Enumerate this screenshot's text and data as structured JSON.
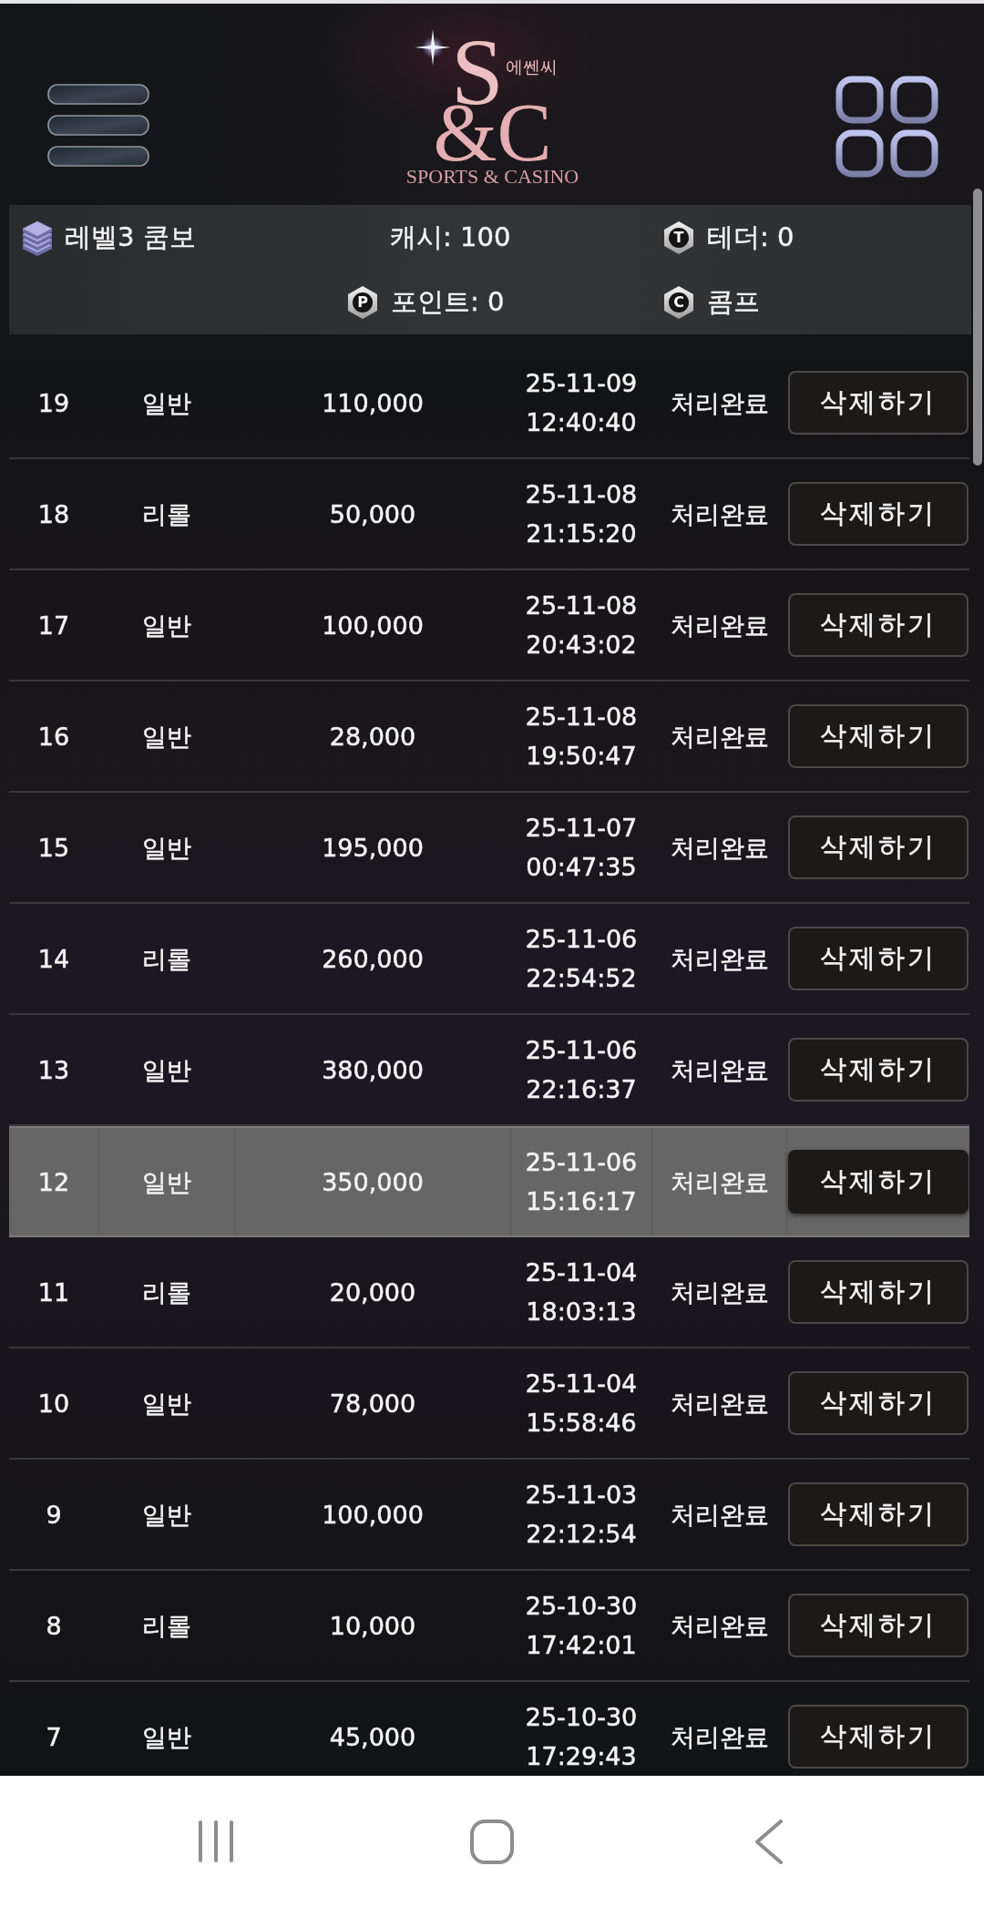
{
  "header": {
    "logo": {
      "monogram_top": "S",
      "korean_name": "에쎈씨",
      "monogram_bottom": "&C",
      "tagline": "SPORTS & CASINO"
    }
  },
  "account_bar": {
    "lines": [
      [
        {
          "kind": "level",
          "text": "레벨3 쿰보"
        },
        {
          "kind": "plain",
          "text": "캐시: 100"
        },
        {
          "kind": "badge",
          "badge": "T",
          "text": "테더: 0"
        }
      ],
      [
        {
          "kind": "badge",
          "badge": "P",
          "text": "포인트: 0"
        },
        {
          "kind": "badge",
          "badge": "C",
          "text": "콤프"
        }
      ]
    ]
  },
  "table": {
    "rows": [
      {
        "number": "19",
        "type": "일반",
        "amount": "110,000",
        "date": "25-11-09",
        "time": "12:40:40",
        "status": "처리완료",
        "action": "삭제하기",
        "selected": false
      },
      {
        "number": "18",
        "type": "리롤",
        "amount": "50,000",
        "date": "25-11-08",
        "time": "21:15:20",
        "status": "처리완료",
        "action": "삭제하기",
        "selected": false
      },
      {
        "number": "17",
        "type": "일반",
        "amount": "100,000",
        "date": "25-11-08",
        "time": "20:43:02",
        "status": "처리완료",
        "action": "삭제하기",
        "selected": false
      },
      {
        "number": "16",
        "type": "일반",
        "amount": "28,000",
        "date": "25-11-08",
        "time": "19:50:47",
        "status": "처리완료",
        "action": "삭제하기",
        "selected": false
      },
      {
        "number": "15",
        "type": "일반",
        "amount": "195,000",
        "date": "25-11-07",
        "time": "00:47:35",
        "status": "처리완료",
        "action": "삭제하기",
        "selected": false
      },
      {
        "number": "14",
        "type": "리롤",
        "amount": "260,000",
        "date": "25-11-06",
        "time": "22:54:52",
        "status": "처리완료",
        "action": "삭제하기",
        "selected": false
      },
      {
        "number": "13",
        "type": "일반",
        "amount": "380,000",
        "date": "25-11-06",
        "time": "22:16:37",
        "status": "처리완료",
        "action": "삭제하기",
        "selected": false
      },
      {
        "number": "12",
        "type": "일반",
        "amount": "350,000",
        "date": "25-11-06",
        "time": "15:16:17",
        "status": "처리완료",
        "action": "삭제하기",
        "selected": true
      },
      {
        "number": "11",
        "type": "리롤",
        "amount": "20,000",
        "date": "25-11-04",
        "time": "18:03:13",
        "status": "처리완료",
        "action": "삭제하기",
        "selected": false
      },
      {
        "number": "10",
        "type": "일반",
        "amount": "78,000",
        "date": "25-11-04",
        "time": "15:58:46",
        "status": "처리완료",
        "action": "삭제하기",
        "selected": false
      },
      {
        "number": "9",
        "type": "일반",
        "amount": "100,000",
        "date": "25-11-03",
        "time": "22:12:54",
        "status": "처리완료",
        "action": "삭제하기",
        "selected": false
      },
      {
        "number": "8",
        "type": "리롤",
        "amount": "10,000",
        "date": "25-10-30",
        "time": "17:42:01",
        "status": "처리완료",
        "action": "삭제하기",
        "selected": false
      },
      {
        "number": "7",
        "type": "일반",
        "amount": "45,000",
        "date": "25-10-30",
        "time": "17:29:43",
        "status": "처리완료",
        "action": "삭제하기",
        "selected": false
      }
    ]
  }
}
